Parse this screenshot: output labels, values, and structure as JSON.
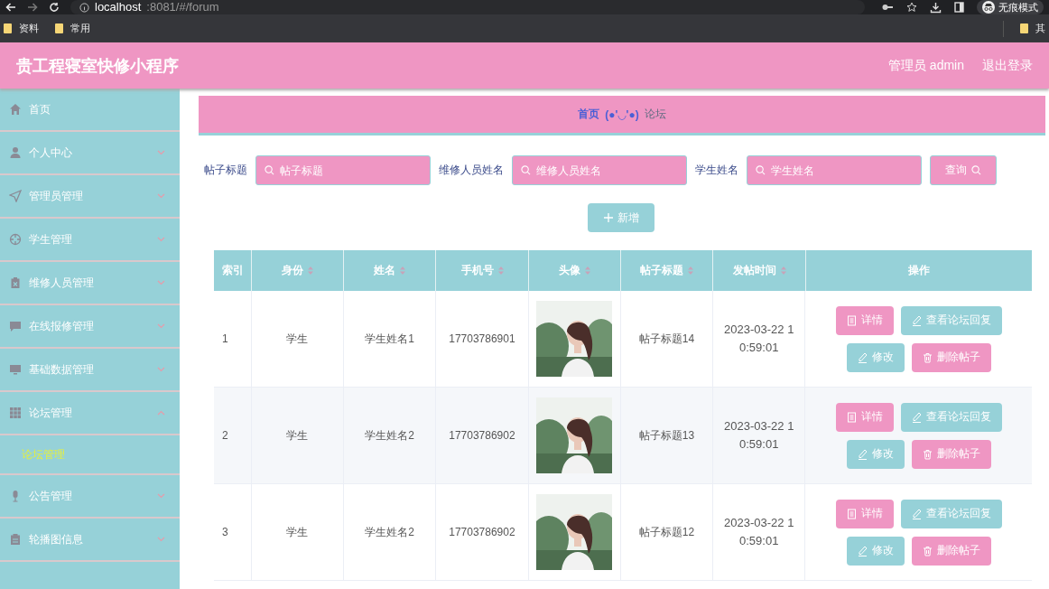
{
  "browser": {
    "url_host": "localhost",
    "url_path": ":8081/#/forum",
    "incognito": "无痕模式",
    "bookmarks": [
      "资料",
      "常用"
    ],
    "bookmarks_right": [
      "其"
    ]
  },
  "header": {
    "title": "贵工程寝室快修小程序",
    "user": "管理员 admin",
    "logout": "退出登录"
  },
  "sidebar": {
    "items": [
      {
        "label": "首页",
        "selected": false
      },
      {
        "label": "个人中心",
        "expanded": false
      },
      {
        "label": "管理员管理",
        "expanded": false
      },
      {
        "label": "学生管理",
        "expanded": false
      },
      {
        "label": "维修人员管理",
        "expanded": false
      },
      {
        "label": "在线报修管理",
        "expanded": false
      },
      {
        "label": "基础数据管理",
        "expanded": false
      },
      {
        "label": "论坛管理",
        "expanded": true,
        "children": [
          {
            "label": "论坛管理",
            "selected": true
          }
        ]
      },
      {
        "label": "公告管理",
        "expanded": false
      },
      {
        "label": "轮播图信息",
        "expanded": false
      }
    ]
  },
  "breadcrumb": {
    "home": "首页",
    "face": "(●'◡'●)",
    "current": "论坛"
  },
  "search": {
    "fields": [
      {
        "label": "帖子标题",
        "placeholder": "帖子标题"
      },
      {
        "label": "维修人员姓名",
        "placeholder": "维修人员姓名"
      },
      {
        "label": "学生姓名",
        "placeholder": "学生姓名"
      }
    ],
    "button": "查询"
  },
  "add_button": "新增",
  "table": {
    "columns": [
      {
        "label": "索引",
        "sortable": false
      },
      {
        "label": "身份",
        "sortable": true
      },
      {
        "label": "姓名",
        "sortable": true
      },
      {
        "label": "手机号",
        "sortable": true
      },
      {
        "label": "头像",
        "sortable": true
      },
      {
        "label": "帖子标题",
        "sortable": true
      },
      {
        "label": "发帖时间",
        "sortable": true
      },
      {
        "label": "操作",
        "sortable": false
      }
    ],
    "rows": [
      {
        "index": "1",
        "role": "学生",
        "name": "学生姓名1",
        "phone": "17703786901",
        "title": "帖子标题14",
        "time": "2023-03-22 10:59:01",
        "actions": [
          {
            "kind": "detail",
            "label": "详情"
          },
          {
            "kind": "reply",
            "label": "查看论坛回复"
          },
          {
            "kind": "edit",
            "label": "修改"
          },
          {
            "kind": "delete",
            "label": "删除帖子"
          }
        ]
      },
      {
        "index": "2",
        "role": "学生",
        "name": "学生姓名2",
        "phone": "17703786902",
        "title": "帖子标题13",
        "time": "2023-03-22 10:59:01",
        "actions": [
          {
            "kind": "detail",
            "label": "详情"
          },
          {
            "kind": "reply",
            "label": "查看论坛回复"
          },
          {
            "kind": "edit",
            "label": "修改"
          },
          {
            "kind": "delete",
            "label": "删除帖子"
          }
        ]
      },
      {
        "index": "3",
        "role": "学生",
        "name": "学生姓名2",
        "phone": "17703786902",
        "title": "帖子标题12",
        "time": "2023-03-22 10:59:01",
        "actions": [
          {
            "kind": "detail",
            "label": "详情"
          },
          {
            "kind": "reply",
            "label": "查看论坛回复"
          },
          {
            "kind": "edit",
            "label": "修改"
          },
          {
            "kind": "delete",
            "label": "删除帖子"
          }
        ]
      }
    ]
  }
}
